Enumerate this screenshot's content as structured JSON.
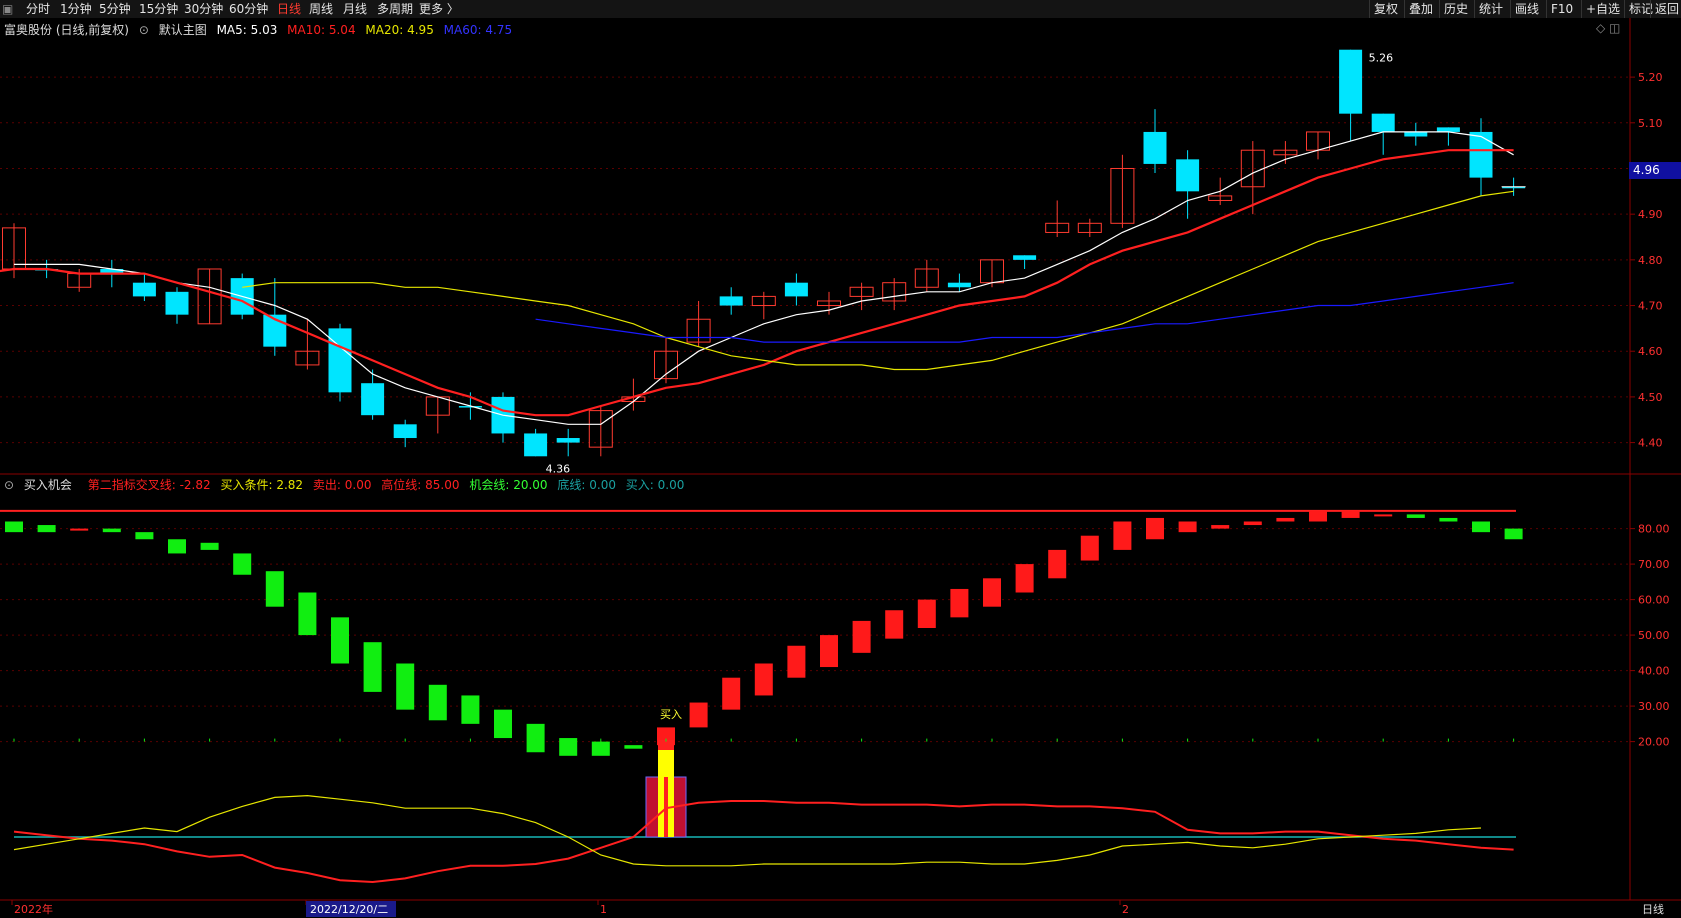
{
  "toolbar": {
    "periods": [
      "分时",
      "1分钟",
      "5分钟",
      "15分钟",
      "30分钟",
      "60分钟",
      "日线",
      "周线",
      "月线",
      "多周期",
      "更多 〉"
    ],
    "active_period": "日线",
    "right_buttons": [
      "复权",
      "叠加",
      "历史",
      "统计",
      "画线",
      "F10",
      "+自选",
      "标记",
      "返回"
    ]
  },
  "main_legend": {
    "stock": "富奥股份 (日线,前复权)",
    "template": "默认主图",
    "ma5": "MA5: 5.03",
    "ma10": "MA10: 5.04",
    "ma20": "MA20: 4.95",
    "ma60": "MA60: 4.75"
  },
  "indicator_legend": {
    "name": "买入机会",
    "cross": "第二指标交叉线: -2.82",
    "cond": "买入条件: 2.82",
    "sell": "卖出: 0.00",
    "high": "高位线: 85.00",
    "chance": "机会线: 20.00",
    "bottom": "底线: 0.00",
    "buy": "买入: 0.00"
  },
  "annotations": {
    "high_label": "5.26",
    "low_label": "4.36",
    "buy_signal": "买入",
    "current_price": "4.96"
  },
  "xaxis": {
    "labels": [
      "2022年",
      "2022/12/20/二",
      "1",
      "2"
    ],
    "footer_right": "日线"
  },
  "chart_data": [
    {
      "type": "candlestick",
      "title": "富奥股份 (日线,前复权)",
      "ylim": [
        4.34,
        5.29
      ],
      "yticks": [
        4.4,
        4.5,
        4.6,
        4.7,
        4.8,
        4.9,
        5.0,
        5.1,
        5.2
      ],
      "candles": [
        {
          "o": 4.78,
          "h": 4.88,
          "l": 4.76,
          "c": 4.87
        },
        {
          "o": 4.78,
          "h": 4.8,
          "l": 4.76,
          "c": 4.78
        },
        {
          "o": 4.74,
          "h": 4.78,
          "l": 4.73,
          "c": 4.77
        },
        {
          "o": 4.78,
          "h": 4.8,
          "l": 4.74,
          "c": 4.77
        },
        {
          "o": 4.75,
          "h": 4.77,
          "l": 4.71,
          "c": 4.72
        },
        {
          "o": 4.73,
          "h": 4.74,
          "l": 4.66,
          "c": 4.68
        },
        {
          "o": 4.66,
          "h": 4.78,
          "l": 4.66,
          "c": 4.78
        },
        {
          "o": 4.76,
          "h": 4.77,
          "l": 4.67,
          "c": 4.68
        },
        {
          "o": 4.68,
          "h": 4.76,
          "l": 4.59,
          "c": 4.61
        },
        {
          "o": 4.57,
          "h": 4.67,
          "l": 4.56,
          "c": 4.6
        },
        {
          "o": 4.65,
          "h": 4.66,
          "l": 4.49,
          "c": 4.51
        },
        {
          "o": 4.53,
          "h": 4.56,
          "l": 4.45,
          "c": 4.46
        },
        {
          "o": 4.44,
          "h": 4.45,
          "l": 4.39,
          "c": 4.41
        },
        {
          "o": 4.46,
          "h": 4.5,
          "l": 4.42,
          "c": 4.5
        },
        {
          "o": 4.48,
          "h": 4.51,
          "l": 4.45,
          "c": 4.48
        },
        {
          "o": 4.5,
          "h": 4.51,
          "l": 4.4,
          "c": 4.42
        },
        {
          "o": 4.42,
          "h": 4.43,
          "l": 4.37,
          "c": 4.37
        },
        {
          "o": 4.41,
          "h": 4.43,
          "l": 4.37,
          "c": 4.4
        },
        {
          "o": 4.39,
          "h": 4.48,
          "l": 4.37,
          "c": 4.47
        },
        {
          "o": 4.49,
          "h": 4.54,
          "l": 4.47,
          "c": 4.5
        },
        {
          "o": 4.54,
          "h": 4.63,
          "l": 4.53,
          "c": 4.6
        },
        {
          "o": 4.62,
          "h": 4.71,
          "l": 4.61,
          "c": 4.67
        },
        {
          "o": 4.72,
          "h": 4.74,
          "l": 4.68,
          "c": 4.7
        },
        {
          "o": 4.7,
          "h": 4.73,
          "l": 4.67,
          "c": 4.72
        },
        {
          "o": 4.75,
          "h": 4.77,
          "l": 4.7,
          "c": 4.72
        },
        {
          "o": 4.7,
          "h": 4.73,
          "l": 4.68,
          "c": 4.71
        },
        {
          "o": 4.72,
          "h": 4.75,
          "l": 4.69,
          "c": 4.74
        },
        {
          "o": 4.71,
          "h": 4.76,
          "l": 4.69,
          "c": 4.75
        },
        {
          "o": 4.74,
          "h": 4.8,
          "l": 4.73,
          "c": 4.78
        },
        {
          "o": 4.75,
          "h": 4.77,
          "l": 4.73,
          "c": 4.74
        },
        {
          "o": 4.75,
          "h": 4.8,
          "l": 4.74,
          "c": 4.8
        },
        {
          "o": 4.81,
          "h": 4.81,
          "l": 4.78,
          "c": 4.8
        },
        {
          "o": 4.86,
          "h": 4.93,
          "l": 4.85,
          "c": 4.88
        },
        {
          "o": 4.86,
          "h": 4.89,
          "l": 4.85,
          "c": 4.88
        },
        {
          "o": 4.88,
          "h": 5.03,
          "l": 4.87,
          "c": 5.0
        },
        {
          "o": 5.08,
          "h": 5.13,
          "l": 4.99,
          "c": 5.01
        },
        {
          "o": 5.02,
          "h": 5.04,
          "l": 4.89,
          "c": 4.95
        },
        {
          "o": 4.93,
          "h": 4.98,
          "l": 4.92,
          "c": 4.94
        },
        {
          "o": 4.96,
          "h": 5.06,
          "l": 4.9,
          "c": 5.04
        },
        {
          "o": 5.03,
          "h": 5.06,
          "l": 5.01,
          "c": 5.04
        },
        {
          "o": 5.04,
          "h": 5.08,
          "l": 5.02,
          "c": 5.08
        },
        {
          "o": 5.26,
          "h": 5.26,
          "l": 5.06,
          "c": 5.12
        },
        {
          "o": 5.12,
          "h": 5.12,
          "l": 5.03,
          "c": 5.08
        },
        {
          "o": 5.08,
          "h": 5.1,
          "l": 5.05,
          "c": 5.07
        },
        {
          "o": 5.09,
          "h": 5.09,
          "l": 5.05,
          "c": 5.08
        },
        {
          "o": 5.08,
          "h": 5.11,
          "l": 4.94,
          "c": 4.98
        },
        {
          "o": 4.96,
          "h": 4.98,
          "l": 4.94,
          "c": 4.96
        }
      ],
      "series": [
        {
          "name": "MA5",
          "color": "#ffffff",
          "values": [
            4.79,
            4.79,
            4.79,
            4.78,
            4.77,
            4.75,
            4.74,
            4.72,
            4.7,
            4.67,
            4.61,
            4.55,
            4.52,
            4.5,
            4.48,
            4.46,
            4.45,
            4.44,
            4.44,
            4.49,
            4.55,
            4.6,
            4.63,
            4.66,
            4.68,
            4.69,
            4.71,
            4.72,
            4.73,
            4.73,
            4.75,
            4.76,
            4.79,
            4.82,
            4.86,
            4.89,
            4.93,
            4.95,
            4.99,
            5.02,
            5.04,
            5.06,
            5.08,
            5.08,
            5.08,
            5.07,
            5.03
          ]
        },
        {
          "name": "MA10",
          "color": "#ff2020",
          "values": [
            4.75,
            4.76,
            4.77,
            4.78,
            4.78,
            4.77,
            4.77,
            4.77,
            4.75,
            4.73,
            4.71,
            4.67,
            4.64,
            4.61,
            4.58,
            4.55,
            4.52,
            4.5,
            4.47,
            4.46,
            4.46,
            4.48,
            4.5,
            4.52,
            4.53,
            4.55,
            4.57,
            4.6,
            4.62,
            4.64,
            4.66,
            4.68,
            4.7,
            4.71,
            4.72,
            4.75,
            4.79,
            4.82,
            4.84,
            4.86,
            4.89,
            4.92,
            4.95,
            4.98,
            5.0,
            5.02,
            5.03,
            5.04,
            5.04,
            5.04
          ]
        },
        {
          "name": "MA20",
          "color": "#e6e600",
          "values": [
            4.74,
            4.75,
            4.75,
            4.75,
            4.75,
            4.74,
            4.74,
            4.73,
            4.72,
            4.71,
            4.7,
            4.68,
            4.66,
            4.63,
            4.61,
            4.59,
            4.58,
            4.57,
            4.57,
            4.57,
            4.56,
            4.56,
            4.57,
            4.58,
            4.6,
            4.62,
            4.64,
            4.66,
            4.69,
            4.72,
            4.75,
            4.78,
            4.81,
            4.84,
            4.86,
            4.88,
            4.9,
            4.92,
            4.94,
            4.95
          ]
        },
        {
          "name": "MA60",
          "color": "#1a1aff",
          "values": [
            4.67,
            4.66,
            4.65,
            4.64,
            4.63,
            4.63,
            4.63,
            4.62,
            4.62,
            4.62,
            4.62,
            4.62,
            4.62,
            4.62,
            4.63,
            4.63,
            4.63,
            4.64,
            4.65,
            4.66,
            4.66,
            4.67,
            4.68,
            4.69,
            4.7,
            4.7,
            4.71,
            4.72,
            4.73,
            4.74,
            4.75
          ]
        }
      ]
    },
    {
      "type": "bar",
      "title": "买入机会",
      "ylim": [
        12,
        92
      ],
      "yticks": [
        20,
        30,
        40,
        50,
        60,
        70,
        80
      ],
      "bars": [
        {
          "o": 82,
          "c": 79
        },
        {
          "o": 81,
          "c": 79
        },
        {
          "o": 80,
          "c": 80
        },
        {
          "o": 80,
          "c": 79
        },
        {
          "o": 79,
          "c": 77
        },
        {
          "o": 77,
          "c": 73
        },
        {
          "o": 76,
          "c": 74
        },
        {
          "o": 73,
          "c": 67
        },
        {
          "o": 68,
          "c": 58
        },
        {
          "o": 62,
          "c": 50
        },
        {
          "o": 55,
          "c": 42
        },
        {
          "o": 48,
          "c": 34
        },
        {
          "o": 42,
          "c": 29
        },
        {
          "o": 36,
          "c": 26
        },
        {
          "o": 33,
          "c": 25
        },
        {
          "o": 29,
          "c": 21
        },
        {
          "o": 25,
          "c": 17
        },
        {
          "o": 21,
          "c": 16
        },
        {
          "o": 20,
          "c": 16
        },
        {
          "o": 19,
          "c": 18
        },
        {
          "o": 19,
          "c": 24
        },
        {
          "o": 24,
          "c": 31
        },
        {
          "o": 29,
          "c": 38
        },
        {
          "o": 33,
          "c": 42
        },
        {
          "o": 38,
          "c": 47
        },
        {
          "o": 41,
          "c": 50
        },
        {
          "o": 45,
          "c": 54
        },
        {
          "o": 49,
          "c": 57
        },
        {
          "o": 52,
          "c": 60
        },
        {
          "o": 55,
          "c": 63
        },
        {
          "o": 58,
          "c": 66
        },
        {
          "o": 62,
          "c": 70
        },
        {
          "o": 66,
          "c": 74
        },
        {
          "o": 71,
          "c": 78
        },
        {
          "o": 74,
          "c": 82
        },
        {
          "o": 77,
          "c": 83
        },
        {
          "o": 79,
          "c": 82
        },
        {
          "o": 80,
          "c": 81
        },
        {
          "o": 81,
          "c": 82
        },
        {
          "o": 82,
          "c": 83
        },
        {
          "o": 82,
          "c": 85
        },
        {
          "o": 83,
          "c": 85
        },
        {
          "o": 84,
          "c": 84
        },
        {
          "o": 84,
          "c": 83
        },
        {
          "o": 83,
          "c": 82
        },
        {
          "o": 82,
          "c": 79
        },
        {
          "o": 80,
          "c": 77
        }
      ],
      "high_line": 85,
      "chance_line": 20,
      "buy_index": 20
    },
    {
      "type": "line",
      "title": "第二指标交叉线",
      "series": [
        {
          "name": "第二指标交叉线",
          "color": "#ff2020",
          "values": [
            0.3,
            0.1,
            -0.1,
            -0.2,
            -0.4,
            -0.8,
            -1.1,
            -1.0,
            -1.7,
            -2.0,
            -2.4,
            -2.5,
            -2.3,
            -1.9,
            -1.6,
            -1.6,
            -1.5,
            -1.2,
            -0.6,
            0.0,
            1.6,
            1.9,
            2.0,
            2.0,
            1.9,
            1.9,
            1.8,
            1.8,
            1.8,
            1.7,
            1.8,
            1.8,
            1.7,
            1.7,
            1.6,
            1.4,
            0.4,
            0.2,
            0.2,
            0.3,
            0.3,
            0.1,
            -0.1,
            -0.2,
            -0.4,
            -0.6,
            -0.7
          ]
        },
        {
          "name": "买入条件",
          "color": "#e6e600",
          "values": [
            -0.7,
            -0.4,
            -0.1,
            0.2,
            0.5,
            0.3,
            1.1,
            1.7,
            2.2,
            2.3,
            2.1,
            1.9,
            1.6,
            1.6,
            1.6,
            1.3,
            0.8,
            0.0,
            -1.0,
            -1.5,
            -1.6,
            -1.6,
            -1.6,
            -1.5,
            -1.5,
            -1.5,
            -1.5,
            -1.5,
            -1.4,
            -1.4,
            -1.5,
            -1.5,
            -1.3,
            -1.0,
            -0.5,
            -0.4,
            -0.3,
            -0.5,
            -0.6,
            -0.4,
            -0.1,
            0.0,
            0.1,
            0.2,
            0.4,
            0.5
          ]
        }
      ],
      "baseline": 0
    }
  ]
}
